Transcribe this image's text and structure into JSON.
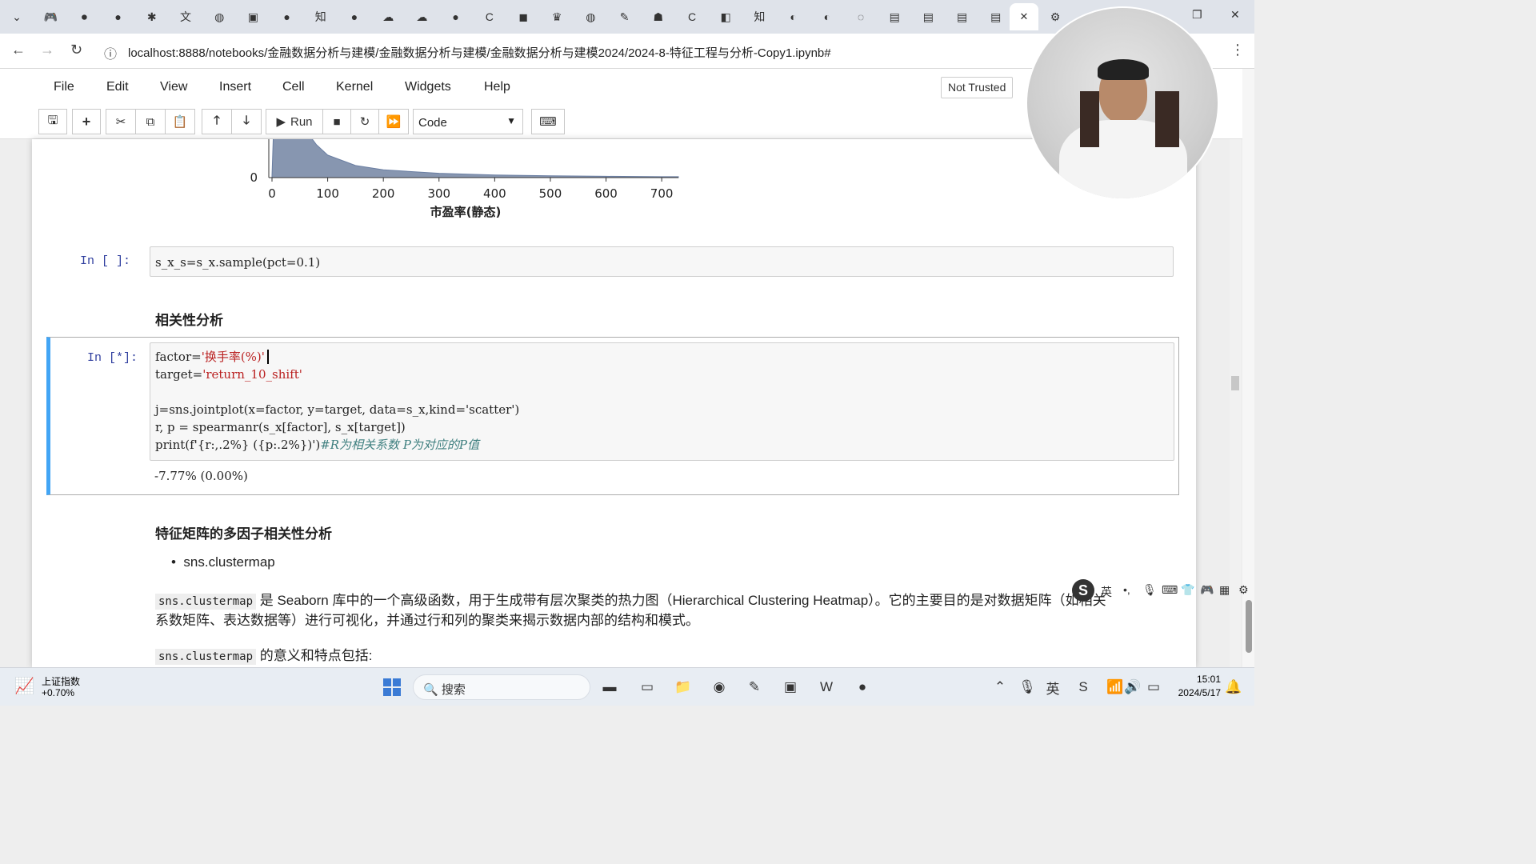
{
  "browser": {
    "tab_icons": [
      "dropdown-icon",
      "game-icon",
      "record-icon",
      "github-icon",
      "puzzle-icon",
      "translate-icon",
      "globe-icon",
      "video-icon",
      "github-icon",
      "zhihu-icon",
      "github-icon",
      "cloud-icon",
      "cloud-icon",
      "github-icon",
      "c-icon",
      "bilibili-icon",
      "crown-icon",
      "globe-icon",
      "pen-icon",
      "robot-icon",
      "c-icon",
      "media-icon",
      "zhihu-icon",
      "chart-icon",
      "chart-icon",
      "loading-icon",
      "book-icon",
      "book-icon",
      "book-icon",
      "book-icon"
    ],
    "url": "localhost:8888/notebooks/金融数据分析与建模/金融数据分析与建模/金融数据分析与建模2024/2024-8-特征工程与分析-Copy1.ipynb#"
  },
  "jupyter": {
    "menu": [
      "File",
      "Edit",
      "View",
      "Insert",
      "Cell",
      "Kernel",
      "Widgets",
      "Help"
    ],
    "trust": "Not Trusted",
    "run_label": "Run",
    "cell_type": "Code"
  },
  "chart_data": {
    "type": "area",
    "xlabel": "市盈率(静态)",
    "x_ticks": [
      "0",
      "100",
      "200",
      "300",
      "400",
      "500",
      "600",
      "700"
    ],
    "y_ticks": [
      "0"
    ],
    "xlim": [
      0,
      730
    ],
    "x": [
      0,
      5,
      10,
      20,
      40,
      60,
      80,
      100,
      150,
      200,
      300,
      400,
      500,
      600,
      700,
      730
    ],
    "y": [
      0.02,
      1.0,
      0.98,
      0.9,
      0.75,
      0.55,
      0.38,
      0.26,
      0.14,
      0.09,
      0.05,
      0.03,
      0.02,
      0.015,
      0.01,
      0.01
    ]
  },
  "cells": {
    "sample": {
      "prompt": "In [ ]:",
      "code": "s_x_s=s_x.sample(pct=0.1)"
    },
    "corr_heading": "相关性分析",
    "corr": {
      "prompt": "In [*]:",
      "line1_a": "factor=",
      "line1_b": "'换手率(%)'",
      "line2_a": "target=",
      "line2_b": "'return_10_shift'",
      "line4": "j=sns.jointplot(x=factor, y=target, data=s_x,kind='scatter')",
      "line5": "r, p = spearmanr(s_x[factor], s_x[target])",
      "line6_a": "print(f'{r:,.2%} ({p:.2%})')",
      "line6_b": "#R为相关系数 P为对应的P值",
      "output": "-7.77% (0.00%)"
    },
    "cluster_heading": "特征矩阵的多因子相关性分析",
    "bullet": "sns.clustermap",
    "para1_code": "sns.clustermap",
    "para1_text": "是 Seaborn 库中的一个高级函数，用于生成带有层次聚类的热力图（Hierarchical Clustering Heatmap）。它的主要目的是对数据矩阵（如相关",
    "para1_line2": "系数矩阵、表达数据等）进行可视化，并通过行和列的聚类来揭示数据内部的结构和模式。",
    "para2_code": "sns.clustermap",
    "para2_text": "的意义和特点包括:"
  },
  "ime": {
    "label": "英"
  },
  "taskbar": {
    "stock_name": "上证指数",
    "stock_change": "+0.70%",
    "search": "搜索",
    "time": "15:01",
    "date": "2024/5/17"
  }
}
